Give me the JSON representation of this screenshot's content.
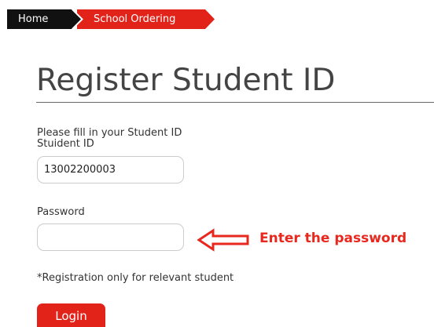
{
  "breadcrumb": {
    "home_label": "Home",
    "current_label": "School Ordering"
  },
  "page": {
    "title": "Register Student ID",
    "instruction": "Please fill in your Student ID"
  },
  "form": {
    "student_id": {
      "label": "Stuident ID",
      "value": "13002200003"
    },
    "password": {
      "label": "Password",
      "value": ""
    },
    "note": "*Registration only for relevant student",
    "login_label": "Login"
  },
  "annotation": {
    "text": "Enter the password"
  },
  "colors": {
    "accent_red": "#e2231a",
    "breadcrumb_dark": "#111111",
    "annotation_red": "#e8281e"
  }
}
